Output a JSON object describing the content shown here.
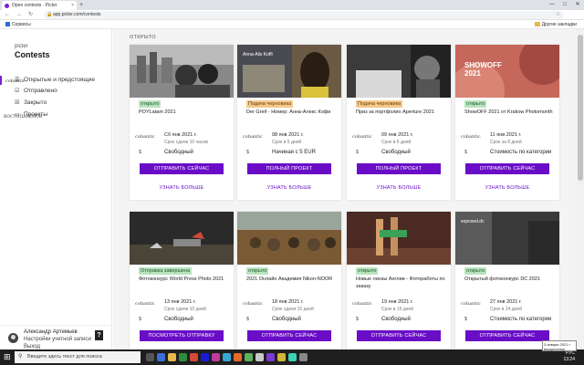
{
  "browser": {
    "tab_title": "Open contests · Picter",
    "tab_close": "×",
    "new_tab": "+",
    "url": "app.picter.com/contests",
    "bookmarks_left": "Сервисы",
    "bookmarks_right": "Другие закладки",
    "win_min": "—",
    "win_max": "□",
    "win_close": "✕",
    "nav_back": "←",
    "nav_fwd": "→",
    "nav_reload": "↻"
  },
  "sidebar": {
    "brand": "picter",
    "title": "Contests",
    "items": [
      {
        "label": "Открытые и предстоящие"
      },
      {
        "label": "Отправлено"
      },
      {
        "label": "Закрыто"
      },
      {
        "label": "Проекты"
      }
    ],
    "watermark1": "cobantic",
    "watermark2": "BOCTOПАУЕНOВ",
    "user": {
      "name": "Александр Артемьев",
      "settings": "Настройки учетной записи",
      "logout": "Выход",
      "help": "?"
    }
  },
  "main": {
    "section_label": "ОТКРЫТО",
    "more_label": "УЗНАТЬ БОЛЬШЕ",
    "card_watermark": "cobantic",
    "cards": [
      {
        "badge": "открыто",
        "badge_color": "#b9e3bf",
        "title": "POYLatam 2021",
        "date": "Сб янв 2021 г.",
        "deadline": "Срок сдачи 10 часов",
        "fee": "Свободный",
        "button": "ОТПРАВИТЬ СЕЙЧАС",
        "img_label": ""
      },
      {
        "badge": "Подача черновика",
        "badge_color": "#f4c98d",
        "title": "Der Greif - Номер: Анна-Алекс Кофи",
        "date": "08 янв 2021 г.",
        "deadline": "Срок в 5 дней",
        "fee": "Начиная с 5 EUR",
        "button": "ПОЛНЫЙ ПРОЕКТ",
        "img_label": "Anna-Alix Koffi"
      },
      {
        "badge": "Подача черновика",
        "badge_color": "#f4c98d",
        "title": "Приз за портфолио Aperture 2021",
        "date": "09 янв 2021 г.",
        "deadline": "Срок в 6 дней",
        "fee": "Свободный",
        "button": "ПОЛНЫЙ ПРОЕКТ",
        "img_label": ""
      },
      {
        "badge": "открыто",
        "badge_color": "#b9e3bf",
        "title": "ShowOFF 2021 от Krakow Photomonth",
        "date": "11 янв 2021 г.",
        "deadline": "Срок за 8 дней",
        "fee": "Стоимость по категории",
        "button": "ОТПРАВИТЬ СЕЙЧАС",
        "img_label": "SHOWOFF 2021"
      },
      {
        "badge": "Отправка завершена",
        "badge_color": "#b9e3bf",
        "title": "Фотоконкурс World Press Photo 2021",
        "date": "13 янв 2021 г.",
        "deadline": "Срок сдачи 10 дней",
        "fee": "Свободный",
        "button": "ПОСМОТРЕТЬ ОТПРАВКУ",
        "img_label": ""
      },
      {
        "badge": "открыто",
        "badge_color": "#b9e3bf",
        "title": "2021 Онлайн Академия Nikon-NOOR",
        "date": "18 янв 2021 г.",
        "deadline": "Срок сдачи 15 дней",
        "fee": "Свободный",
        "button": "ОТПРАВИТЬ СЕЙЧАС",
        "img_label": ""
      },
      {
        "badge": "открыто",
        "badge_color": "#b9e3bf",
        "title": "Новые линзы Англии - Фотоработы по заказу",
        "date": "19 янв 2021 г.",
        "deadline": "Срок в 16 дней",
        "fee": "Свободный",
        "button": "ОТПРАВИТЬ СЕЙЧАС",
        "img_label": ""
      },
      {
        "badge": "открыто",
        "badge_color": "#b9e3bf",
        "title": "Открытый фотоконкурс DC 2021",
        "date": "27 янв 2021 г.",
        "deadline": "Срок в 24 дней",
        "fee": "Стоимость по категории",
        "button": "ОТПРАВИТЬ СЕЙЧАС",
        "img_label": "exposed.dc"
      }
    ]
  },
  "taskbar": {
    "search_placeholder": "Введите здесь текст для поиска",
    "time": "13:24",
    "date": "03.01.2021",
    "lang": "РУС",
    "toast": "3 января 2021 г. воскресенье"
  }
}
